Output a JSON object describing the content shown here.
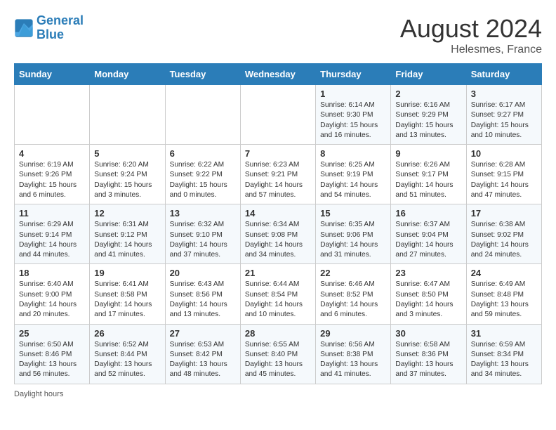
{
  "header": {
    "logo_line1": "General",
    "logo_line2": "Blue",
    "month_title": "August 2024",
    "location": "Helesmes, France"
  },
  "days_of_week": [
    "Sunday",
    "Monday",
    "Tuesday",
    "Wednesday",
    "Thursday",
    "Friday",
    "Saturday"
  ],
  "weeks": [
    [
      {
        "day": "",
        "text": ""
      },
      {
        "day": "",
        "text": ""
      },
      {
        "day": "",
        "text": ""
      },
      {
        "day": "",
        "text": ""
      },
      {
        "day": "1",
        "text": "Sunrise: 6:14 AM\nSunset: 9:30 PM\nDaylight: 15 hours and 16 minutes."
      },
      {
        "day": "2",
        "text": "Sunrise: 6:16 AM\nSunset: 9:29 PM\nDaylight: 15 hours and 13 minutes."
      },
      {
        "day": "3",
        "text": "Sunrise: 6:17 AM\nSunset: 9:27 PM\nDaylight: 15 hours and 10 minutes."
      }
    ],
    [
      {
        "day": "4",
        "text": "Sunrise: 6:19 AM\nSunset: 9:26 PM\nDaylight: 15 hours and 6 minutes."
      },
      {
        "day": "5",
        "text": "Sunrise: 6:20 AM\nSunset: 9:24 PM\nDaylight: 15 hours and 3 minutes."
      },
      {
        "day": "6",
        "text": "Sunrise: 6:22 AM\nSunset: 9:22 PM\nDaylight: 15 hours and 0 minutes."
      },
      {
        "day": "7",
        "text": "Sunrise: 6:23 AM\nSunset: 9:21 PM\nDaylight: 14 hours and 57 minutes."
      },
      {
        "day": "8",
        "text": "Sunrise: 6:25 AM\nSunset: 9:19 PM\nDaylight: 14 hours and 54 minutes."
      },
      {
        "day": "9",
        "text": "Sunrise: 6:26 AM\nSunset: 9:17 PM\nDaylight: 14 hours and 51 minutes."
      },
      {
        "day": "10",
        "text": "Sunrise: 6:28 AM\nSunset: 9:15 PM\nDaylight: 14 hours and 47 minutes."
      }
    ],
    [
      {
        "day": "11",
        "text": "Sunrise: 6:29 AM\nSunset: 9:14 PM\nDaylight: 14 hours and 44 minutes."
      },
      {
        "day": "12",
        "text": "Sunrise: 6:31 AM\nSunset: 9:12 PM\nDaylight: 14 hours and 41 minutes."
      },
      {
        "day": "13",
        "text": "Sunrise: 6:32 AM\nSunset: 9:10 PM\nDaylight: 14 hours and 37 minutes."
      },
      {
        "day": "14",
        "text": "Sunrise: 6:34 AM\nSunset: 9:08 PM\nDaylight: 14 hours and 34 minutes."
      },
      {
        "day": "15",
        "text": "Sunrise: 6:35 AM\nSunset: 9:06 PM\nDaylight: 14 hours and 31 minutes."
      },
      {
        "day": "16",
        "text": "Sunrise: 6:37 AM\nSunset: 9:04 PM\nDaylight: 14 hours and 27 minutes."
      },
      {
        "day": "17",
        "text": "Sunrise: 6:38 AM\nSunset: 9:02 PM\nDaylight: 14 hours and 24 minutes."
      }
    ],
    [
      {
        "day": "18",
        "text": "Sunrise: 6:40 AM\nSunset: 9:00 PM\nDaylight: 14 hours and 20 minutes."
      },
      {
        "day": "19",
        "text": "Sunrise: 6:41 AM\nSunset: 8:58 PM\nDaylight: 14 hours and 17 minutes."
      },
      {
        "day": "20",
        "text": "Sunrise: 6:43 AM\nSunset: 8:56 PM\nDaylight: 14 hours and 13 minutes."
      },
      {
        "day": "21",
        "text": "Sunrise: 6:44 AM\nSunset: 8:54 PM\nDaylight: 14 hours and 10 minutes."
      },
      {
        "day": "22",
        "text": "Sunrise: 6:46 AM\nSunset: 8:52 PM\nDaylight: 14 hours and 6 minutes."
      },
      {
        "day": "23",
        "text": "Sunrise: 6:47 AM\nSunset: 8:50 PM\nDaylight: 14 hours and 3 minutes."
      },
      {
        "day": "24",
        "text": "Sunrise: 6:49 AM\nSunset: 8:48 PM\nDaylight: 13 hours and 59 minutes."
      }
    ],
    [
      {
        "day": "25",
        "text": "Sunrise: 6:50 AM\nSunset: 8:46 PM\nDaylight: 13 hours and 56 minutes."
      },
      {
        "day": "26",
        "text": "Sunrise: 6:52 AM\nSunset: 8:44 PM\nDaylight: 13 hours and 52 minutes."
      },
      {
        "day": "27",
        "text": "Sunrise: 6:53 AM\nSunset: 8:42 PM\nDaylight: 13 hours and 48 minutes."
      },
      {
        "day": "28",
        "text": "Sunrise: 6:55 AM\nSunset: 8:40 PM\nDaylight: 13 hours and 45 minutes."
      },
      {
        "day": "29",
        "text": "Sunrise: 6:56 AM\nSunset: 8:38 PM\nDaylight: 13 hours and 41 minutes."
      },
      {
        "day": "30",
        "text": "Sunrise: 6:58 AM\nSunset: 8:36 PM\nDaylight: 13 hours and 37 minutes."
      },
      {
        "day": "31",
        "text": "Sunrise: 6:59 AM\nSunset: 8:34 PM\nDaylight: 13 hours and 34 minutes."
      }
    ]
  ],
  "footer": {
    "note": "Daylight hours"
  }
}
